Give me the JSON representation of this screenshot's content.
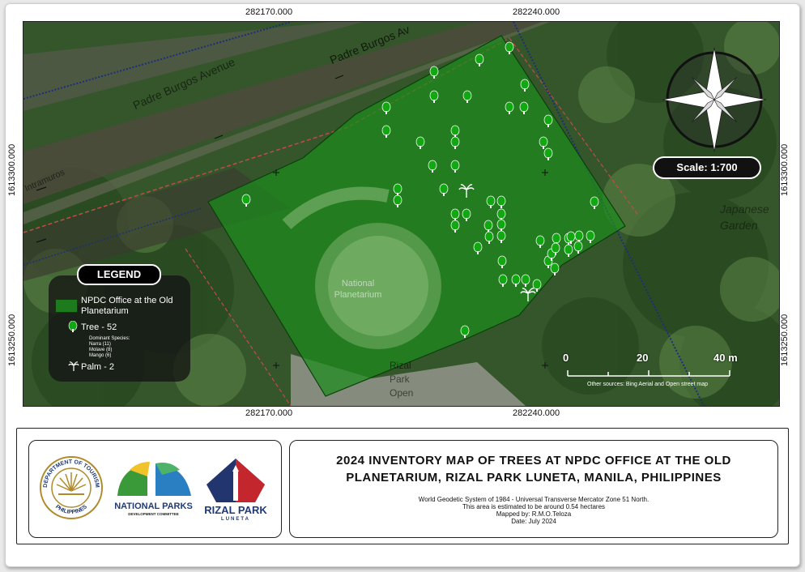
{
  "coords": {
    "top_left": "282170.000",
    "top_right": "282240.000",
    "bottom_left": "282170.000",
    "bottom_right": "282240.000",
    "left_upper": "1613300.000",
    "left_lower": "1613250.000",
    "right_upper": "1613300.000",
    "right_lower": "1613250.000"
  },
  "map": {
    "street_labels": [
      "Padre Burgos Avenue",
      "Padre Burgos Av",
      "Intramuros"
    ],
    "place_labels": {
      "planetarium": "National Planetarium",
      "japanese_garden": "Japanese Garden",
      "rizal_park": "Rizal Park Open"
    },
    "colors": {
      "parcel_fill": "#1d8a1d",
      "tree_icon": "#11a811",
      "boundary_line": "#c44a4a",
      "admin_line": "#1a2f7a"
    }
  },
  "legend": {
    "title": "LEGEND",
    "area_label": "NPDC Office at the Old Planetarium",
    "tree_label": "Tree - 52",
    "species_header": "Dominant Species:",
    "species": [
      "Narra (11)",
      "Molave (8)",
      "Mango (6)"
    ],
    "palm_label": "Palm - 2"
  },
  "scale": {
    "label": "Scale: 1:700",
    "bar_labels": [
      "0",
      "20",
      "40 m"
    ],
    "sources": "Other sources: Bing Aerial and Open street map"
  },
  "title_block": {
    "title_line1": "2024 INVENTORY MAP OF TREES AT NPDC OFFICE AT THE OLD",
    "title_line2": "PLANETARIUM, RIZAL PARK LUNETA, MANILA, PHILIPPINES",
    "info": [
      "World Geodetic System of 1984 - Universal Transverse Mercator Zone 51 North.",
      "This area is estimated to be around 0.54 hectares",
      "Mapped by: R.M.O.Teloza",
      "Date: July 2024"
    ]
  },
  "logos": {
    "dot_text_top": "DEPARTMENT OF TOURISM",
    "dot_text_bottom": "PHILIPPINES",
    "np_title": "NATIONAL PARKS",
    "np_subtitle": "DEVELOPMENT COMMITTEE",
    "rizal_title": "RIZAL PARK",
    "rizal_subtitle": "LUNETA"
  }
}
